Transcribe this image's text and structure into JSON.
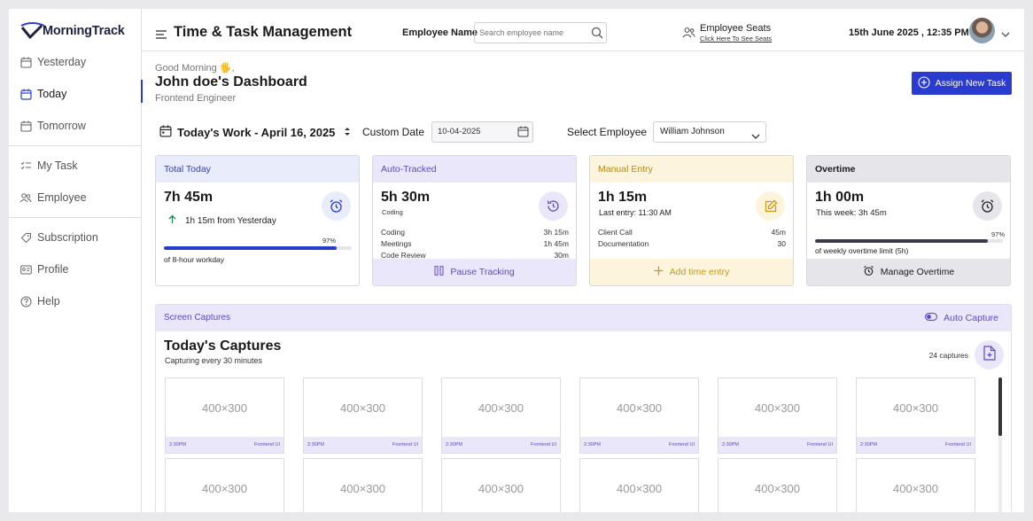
{
  "app": {
    "logo_text": "MorningTrack",
    "page_title": "Time & Task Management"
  },
  "sidebar": {
    "days": [
      {
        "label": "Yesterday",
        "icon": "calendar-icon",
        "active": false
      },
      {
        "label": "Today",
        "icon": "calendar-icon",
        "active": true
      },
      {
        "label": "Tomorrow",
        "icon": "calendar-icon",
        "active": false
      }
    ],
    "work": [
      {
        "label": "My Task",
        "icon": "checklist-icon"
      },
      {
        "label": "Employee",
        "icon": "users-icon"
      }
    ],
    "account": [
      {
        "label": "Subscription",
        "icon": "tag-icon"
      },
      {
        "label": "Profile",
        "icon": "id-card-icon"
      },
      {
        "label": "Help",
        "icon": "help-icon"
      }
    ]
  },
  "header": {
    "employee_label": "Employee Name",
    "search_placeholder": "Search employee name",
    "seats_title": "Employee Seats",
    "seats_link": "Click Here To See Seats",
    "datetime": "15th June 2025 , 12:35 PM"
  },
  "greeting": {
    "hello": "Good Morning 🖐,",
    "title": "John doe's Dashboard",
    "role": "Frontend Engineer",
    "assign_button": "Assign New Task"
  },
  "filters": {
    "work_title": "Today's Work - April 16, 2025",
    "custom_date_label": "Custom Date",
    "custom_date_value": "10-04-2025",
    "select_employee_label": "Select Employee",
    "selected_employee": "William Johnson"
  },
  "cards": {
    "total": {
      "title": "Total Today",
      "value": "7h 45m",
      "trend": "1h 15m from Yesterday",
      "percent_label": "97%",
      "progress": 0.92,
      "note": "of 8-hour workday",
      "accent": "#2a3ccf"
    },
    "auto": {
      "title": "Auto-Tracked",
      "value": "5h 30m",
      "sub": "Coding",
      "rows": [
        {
          "name": "Coding",
          "time": "3h 15m"
        },
        {
          "name": "Meetings",
          "time": "1h 45m"
        },
        {
          "name": "Code Review",
          "time": "30m"
        }
      ],
      "footer": "Pause Tracking"
    },
    "manual": {
      "title": "Manual Entry",
      "value": "1h 15m",
      "sub": "Last entry: 11:30 AM",
      "rows": [
        {
          "name": "Client Call",
          "time": "45m"
        },
        {
          "name": "Documentation",
          "time": "30"
        }
      ],
      "footer": "Add time entry"
    },
    "overtime": {
      "title": "Overtime",
      "value": "1h 00m",
      "sub": "This week: 3h 45m",
      "percent_label": "97%",
      "progress": 0.92,
      "note": "of weekly overtime limit (5h)",
      "footer": "Manage Overtime",
      "accent": "#3a3a4a"
    }
  },
  "captures": {
    "section_label": "Screen Captures",
    "auto_capture_label": "Auto Capture",
    "title": "Today's Captures",
    "subtitle": "Capturing every 30 minutes",
    "count": "24 captures",
    "items": [
      {
        "placeholder": "400×300",
        "time": "2:30PM",
        "tag": "Frontend UI"
      },
      {
        "placeholder": "400×300",
        "time": "2:30PM",
        "tag": "Frontend UI"
      },
      {
        "placeholder": "400×300",
        "time": "2:30PM",
        "tag": "Frontend UI"
      },
      {
        "placeholder": "400×300",
        "time": "2:30PM",
        "tag": "Frontend UI"
      },
      {
        "placeholder": "400×300",
        "time": "2:30PM",
        "tag": "Frontend UI"
      },
      {
        "placeholder": "400×300",
        "time": "2:30PM",
        "tag": "Frontend UI"
      },
      {
        "placeholder": "400×300",
        "time": "",
        "tag": ""
      },
      {
        "placeholder": "400×300",
        "time": "",
        "tag": ""
      },
      {
        "placeholder": "400×300",
        "time": "",
        "tag": ""
      },
      {
        "placeholder": "400×300",
        "time": "",
        "tag": ""
      },
      {
        "placeholder": "400×300",
        "time": "",
        "tag": ""
      },
      {
        "placeholder": "400×300",
        "time": "",
        "tag": ""
      }
    ]
  }
}
